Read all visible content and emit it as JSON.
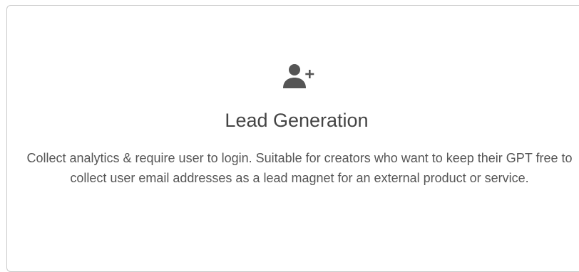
{
  "card": {
    "icon": "user-plus-icon",
    "title": "Lead Generation",
    "description": "Collect analytics & require user to login. Suitable for creators who want to keep their GPT free to collect user email addresses as a lead magnet for an external product or service."
  },
  "colors": {
    "icon": "#555555",
    "title": "#444444",
    "description": "#555555",
    "border": "#c9c9c9"
  }
}
